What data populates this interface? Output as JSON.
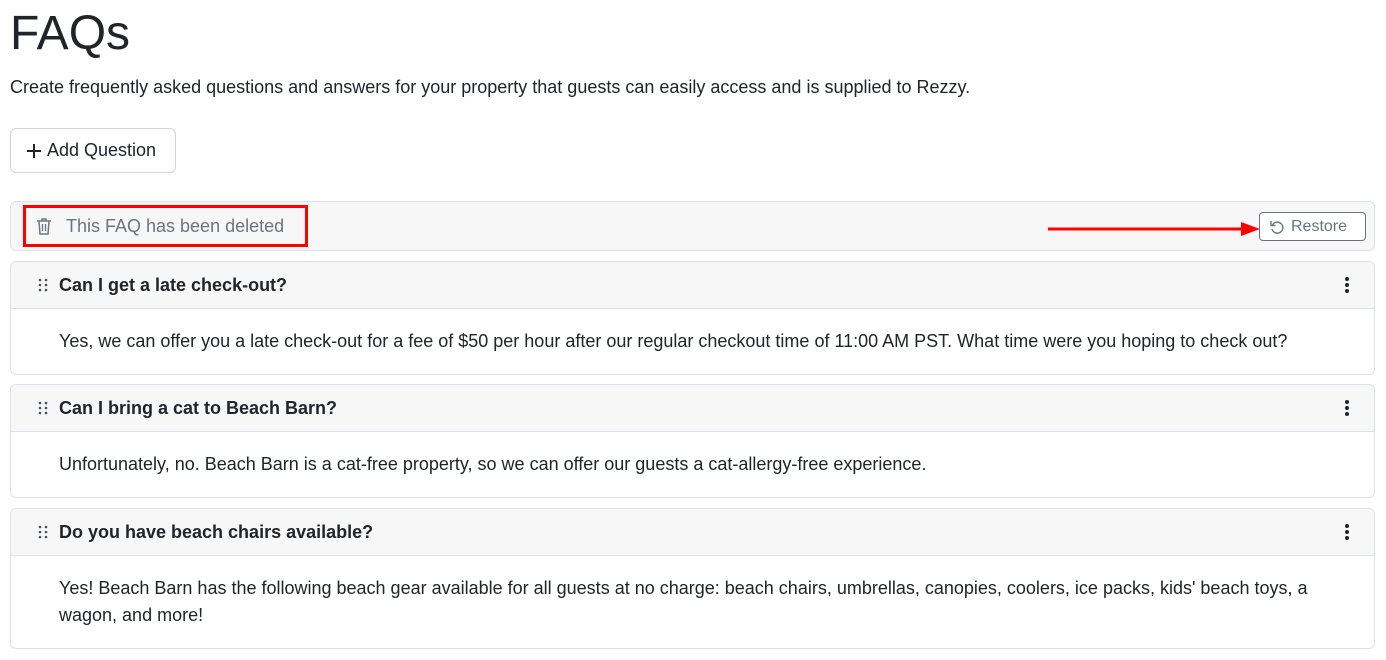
{
  "header": {
    "title": "FAQs",
    "subtitle": "Create frequently asked questions and answers for your property that guests can easily access and is supplied to Rezzy."
  },
  "toolbar": {
    "add_label": "Add Question"
  },
  "deleted": {
    "message": "This FAQ has been deleted",
    "restore_label": "Restore"
  },
  "faqs": [
    {
      "question": "Can I get a late check-out?",
      "answer": "Yes, we can offer you a late check-out for a fee of $50 per hour after our regular checkout time of 11:00 AM PST. What time were you hoping to check out?"
    },
    {
      "question": "Can I bring a cat to Beach Barn?",
      "answer": "Unfortunately, no. Beach Barn is a cat-free property, so we can offer our guests a cat-allergy-free experience."
    },
    {
      "question": "Do you have beach chairs available?",
      "answer": "Yes! Beach Barn has the following beach gear available for all guests at no charge: beach chairs, umbrellas, canopies, coolers, ice packs, kids' beach toys, a wagon, and more!"
    }
  ],
  "colors": {
    "highlight": "#ff0000",
    "muted_text": "#6c757d",
    "header_bg": "#f7f7f7",
    "border": "#dee2e6"
  }
}
